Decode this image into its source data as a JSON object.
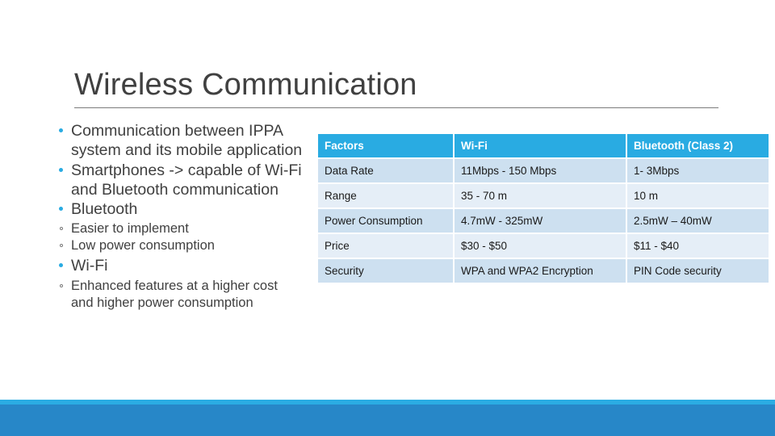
{
  "slide": {
    "title": "Wireless Communication"
  },
  "bullets": [
    {
      "level": 1,
      "text": "Communication between IPPA system and its mobile application"
    },
    {
      "level": 1,
      "text": "Smartphones -> capable of Wi-Fi and Bluetooth communication"
    },
    {
      "level": 1,
      "text": "Bluetooth"
    },
    {
      "level": 2,
      "text": "Easier to implement"
    },
    {
      "level": 2,
      "text": "Low power consumption"
    },
    {
      "level": 1,
      "text": "Wi-Fi"
    },
    {
      "level": 2,
      "text": "Enhanced features at a higher cost and higher power consumption"
    }
  ],
  "table": {
    "headers": [
      "Factors",
      "Wi-Fi",
      "Bluetooth (Class 2)"
    ],
    "rows": [
      [
        "Data Rate",
        "11Mbps - 150 Mbps",
        "1- 3Mbps"
      ],
      [
        "Range",
        "35 - 70 m",
        "10 m"
      ],
      [
        "Power Consumption",
        "4.7mW - 325mW",
        "2.5mW – 40mW"
      ],
      [
        "Price",
        "$30 - $50",
        "$11 - $40"
      ],
      [
        "Security",
        "WPA and WPA2 Encryption",
        "PIN Code security"
      ]
    ]
  },
  "colors": {
    "header_blue": "#29abe2",
    "band_dark": "#cde0f0",
    "band_light": "#e5eef7",
    "accent_light": "#2bace3",
    "accent_dark": "#2787c8",
    "text_gray": "#404040"
  }
}
